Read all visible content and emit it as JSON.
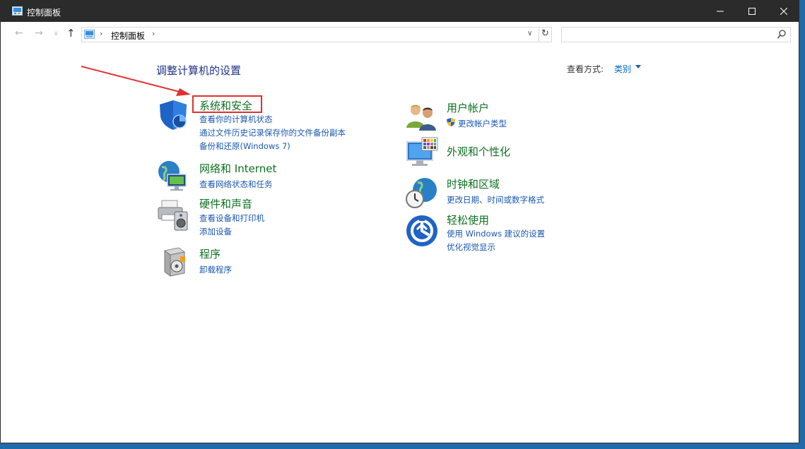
{
  "window": {
    "title": "控制面板",
    "controls": {
      "minimize": "minimize",
      "maximize": "maximize",
      "close": "close"
    }
  },
  "navbar": {
    "breadcrumb": "控制面板",
    "search": {
      "value": "",
      "placeholder": ""
    }
  },
  "main": {
    "heading": "调整计算机的设置",
    "view_by_label": "查看方式:",
    "view_by_value": "类别"
  },
  "categories": [
    {
      "title": "系统和安全",
      "icon": "shield-icon",
      "links": [
        "查看你的计算机状态",
        "通过文件历史记录保存你的文件备份副本",
        "备份和还原(Windows 7)"
      ]
    },
    {
      "title": "网络和 Internet",
      "icon": "network-globe-icon",
      "links": [
        "查看网络状态和任务"
      ]
    },
    {
      "title": "硬件和声音",
      "icon": "printer-speaker-icon",
      "links": [
        "查看设备和打印机",
        "添加设备"
      ]
    },
    {
      "title": "程序",
      "icon": "programs-box-icon",
      "links": [
        "卸载程序"
      ]
    },
    {
      "title": "用户帐户",
      "icon": "users-icon",
      "links": [
        "更改帐户类型"
      ]
    },
    {
      "title": "外观和个性化",
      "icon": "monitor-palette-icon",
      "links": []
    },
    {
      "title": "时钟和区域",
      "icon": "clock-globe-icon",
      "links": [
        "更改日期、时间或数字格式"
      ]
    },
    {
      "title": "轻松使用",
      "icon": "ease-of-access-icon",
      "links": [
        "使用 Windows 建议的设置",
        "优化视觉显示"
      ]
    }
  ],
  "colors": {
    "category_title": "#0e7020",
    "link": "#1a58b0",
    "heading": "#1e3287",
    "annotation": "#e03030"
  }
}
